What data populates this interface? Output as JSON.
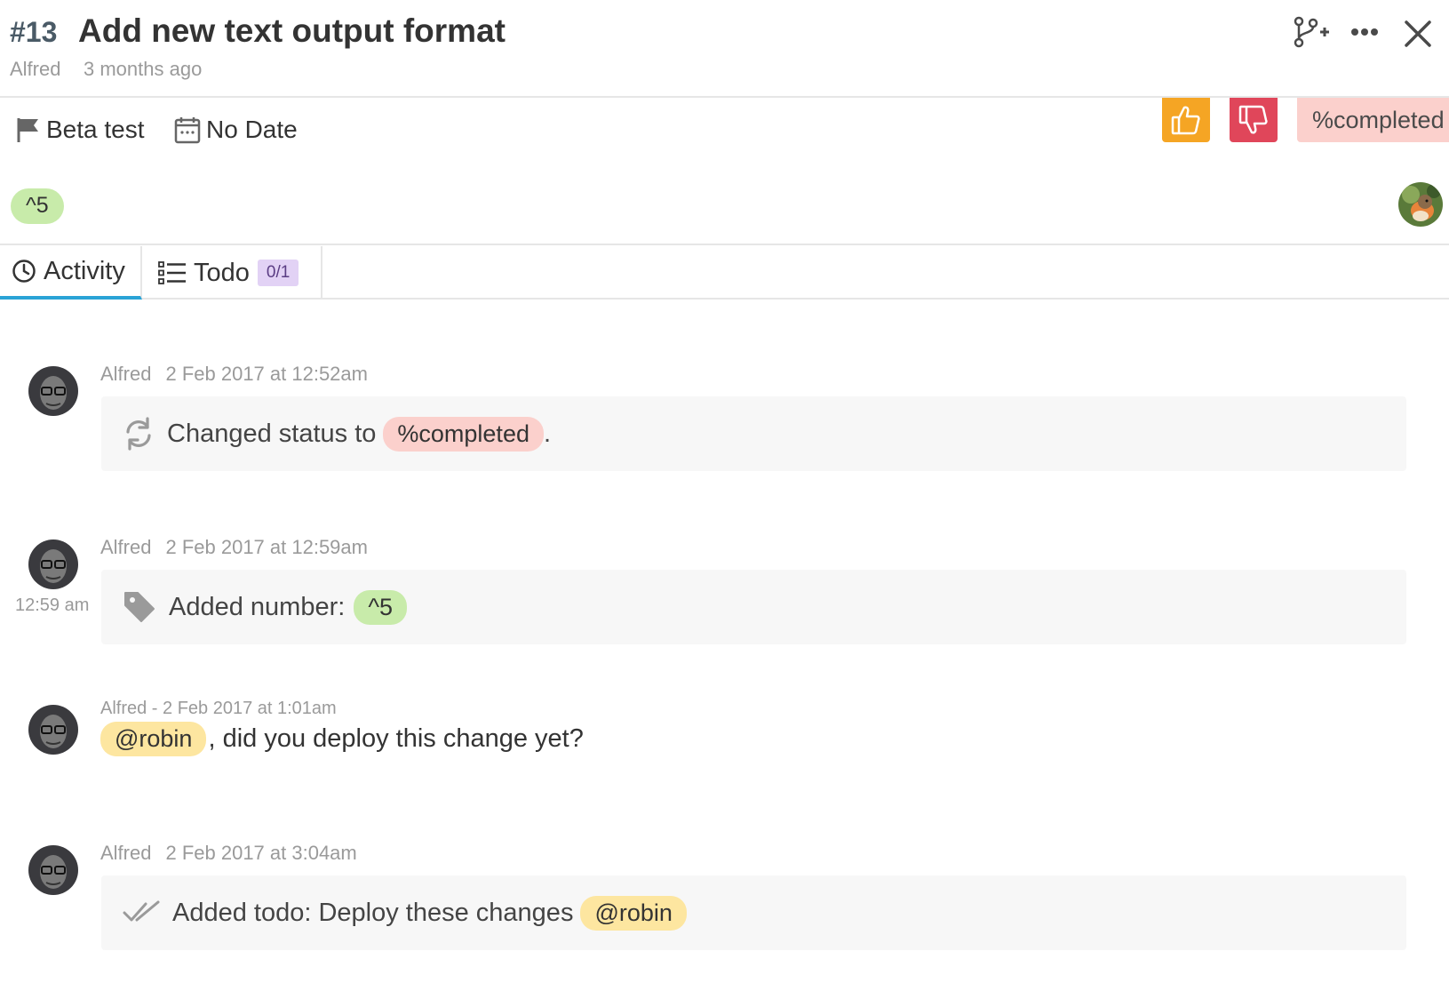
{
  "issue": {
    "number": "#13",
    "title": "Add new text output format",
    "author": "Alfred",
    "created": "3 months ago"
  },
  "header_icons": [
    "branch-add-icon",
    "more-icon",
    "close-icon"
  ],
  "meta": {
    "milestone": "Beta test",
    "due_date": "No Date",
    "status": "%completed",
    "number": "^5"
  },
  "colors": {
    "vote_up": "#f5a524",
    "vote_down": "#e0465a",
    "status": "#fbd0cc",
    "number": "#c8ebaa",
    "mention": "#fde6a0",
    "todo_count": "#e2d2f5",
    "tab_active": "#2aa3d6"
  },
  "tabs": [
    {
      "label": "Activity",
      "icon": "clock-icon",
      "active": true
    },
    {
      "label": "Todo",
      "icon": "list-icon",
      "count": "0/1"
    }
  ],
  "activity": [
    {
      "author": "Alfred",
      "time": "2 Feb 2017 at 12:52am",
      "icon": "refresh-icon",
      "text": "Changed status to",
      "pill": "%completed",
      "suffix": "."
    },
    {
      "author": "Alfred",
      "time": "2 Feb 2017 at 12:59am",
      "side_time": "12:59 am",
      "icon": "tag-icon",
      "text": "Added number:",
      "pill": "^5"
    },
    {
      "meta": "Alfred - 2 Feb 2017 at 1:01am",
      "mention": "@robin",
      "text": ", did you deploy this change yet?"
    },
    {
      "author": "Alfred",
      "time": "2 Feb 2017 at 3:04am",
      "icon": "double-check-icon",
      "text": "Added todo: Deploy these changes",
      "mention": "@robin"
    }
  ]
}
